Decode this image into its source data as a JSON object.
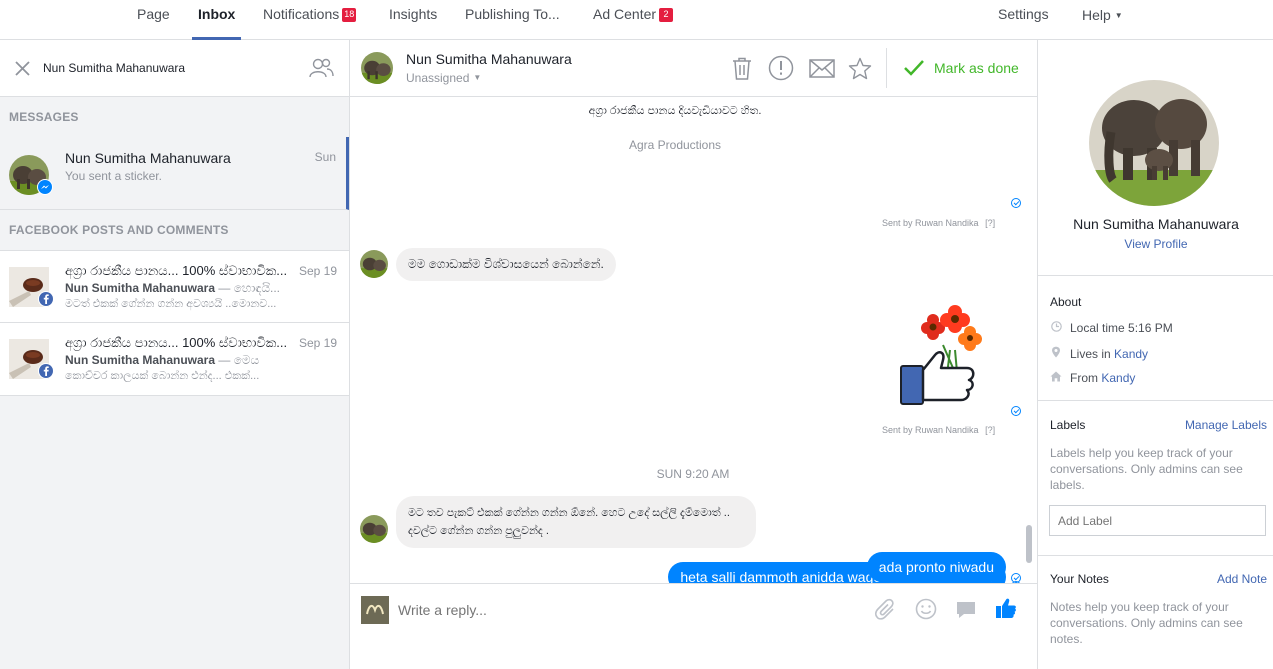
{
  "nav": {
    "tabs": [
      {
        "label": "Page"
      },
      {
        "label": "Inbox"
      },
      {
        "label": "Notifications",
        "badge": "18"
      },
      {
        "label": "Insights"
      },
      {
        "label": "Publishing To..."
      },
      {
        "label": "Ad Center",
        "badge": "2"
      }
    ],
    "settings": "Settings",
    "help": "Help"
  },
  "left": {
    "search_value": "Nun Sumitha Mahanuwara",
    "messages_header": "MESSAGES",
    "message_thread": {
      "name": "Nun Sumitha Mahanuwara",
      "snippet": "You sent a sticker.",
      "time": "Sun"
    },
    "posts_header": "FACEBOOK POSTS AND COMMENTS",
    "posts": [
      {
        "title": "අග්‍රා රාජකීය පානය... 100% ස්වාභාවික...",
        "time": "Sep 19",
        "author": "Nun Sumitha Mahanuwara",
        "author_suffix": " — හොඳයි...",
        "snippet": "මටත් එකක් ගේන්න ගන්න අවශ්‍යයි ..මොනව..."
      },
      {
        "title": "අග්‍රා රාජකීය පානය... 100% ස්වාභාවික...",
        "time": "Sep 19",
        "author": "Nun Sumitha Mahanuwara",
        "author_suffix": " — මෙය",
        "snippet": "කොච්චර කාලයක් බොන්න එන්ද... එකක්..."
      }
    ]
  },
  "conversation": {
    "name": "Nun Sumitha Mahanuwara",
    "assignment": "Unassigned",
    "mark_done": "Mark as done",
    "messages": {
      "top_text": "අග්‍රා රාජකීය පානය දියවැඩියාවට හිත.",
      "agra_label": "Agra Productions",
      "sent_by_1": "Sent by Ruwan Nandika",
      "incoming_1": "මම ගොඩාක්ම විශ්වාසයෙන් බොන්නේ.",
      "sent_by_2": "Sent by Ruwan Nandika",
      "timestamp": "SUN 9:20 AM",
      "incoming_2": "මට තව පැකට් එකක් ගේන්න ගන්න ඕනේ. හෙට උදේ සල්ලි දැම්මොත්  .. දවල්ට ගේන්න ගන්න පුලුවන්ද .",
      "outgoing_1": "heta salli dammoth anidda wage thama hambenne",
      "outgoing_2": "ada pronto niwadu",
      "sent_by_marker": "[?]"
    },
    "composer_placeholder": "Write a reply..."
  },
  "right": {
    "name": "Nun Sumitha Mahanuwara",
    "view_profile": "View Profile",
    "about_title": "About",
    "local_time": "Local time 5:16 PM",
    "lives_in_prefix": "Lives in ",
    "lives_in": "Kandy",
    "from_prefix": "From ",
    "from": "Kandy",
    "labels_title": "Labels",
    "manage_labels": "Manage Labels",
    "labels_help": "Labels help you keep track of your conversations. Only admins can see labels.",
    "add_label_placeholder": "Add Label",
    "notes_title": "Your Notes",
    "add_note": "Add Note",
    "notes_help": "Notes help you keep track of your conversations. Only admins can see notes."
  },
  "colors": {
    "brand_blue": "#4267b2",
    "messenger_blue": "#0084ff",
    "done_green": "#42b72a",
    "badge_red": "#e41e3f"
  }
}
